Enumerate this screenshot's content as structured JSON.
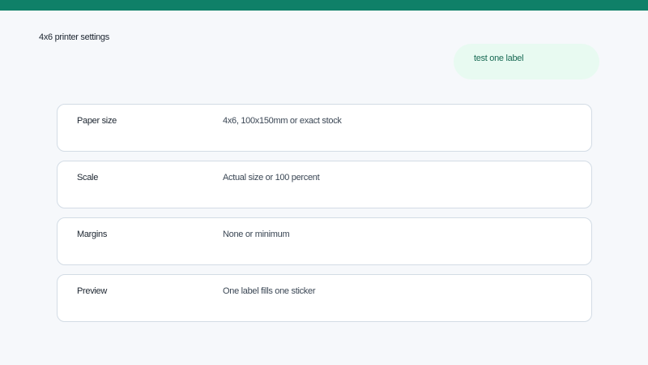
{
  "page": {
    "title": "4x6 printer settings"
  },
  "actions": {
    "test_label": "test one label"
  },
  "settings": [
    {
      "label": "Paper size",
      "value": "4x6, 100x150mm or exact stock"
    },
    {
      "label": "Scale",
      "value": "Actual size or 100 percent"
    },
    {
      "label": "Margins",
      "value": "None or minimum"
    },
    {
      "label": "Preview",
      "value": "One label fills one sticker"
    }
  ],
  "colors": {
    "brand": "#0f8068",
    "pill_background": "#e8faf1",
    "pill_text": "#1a6b55",
    "card_border": "#d3dce5",
    "page_background": "#f6f8fb"
  }
}
